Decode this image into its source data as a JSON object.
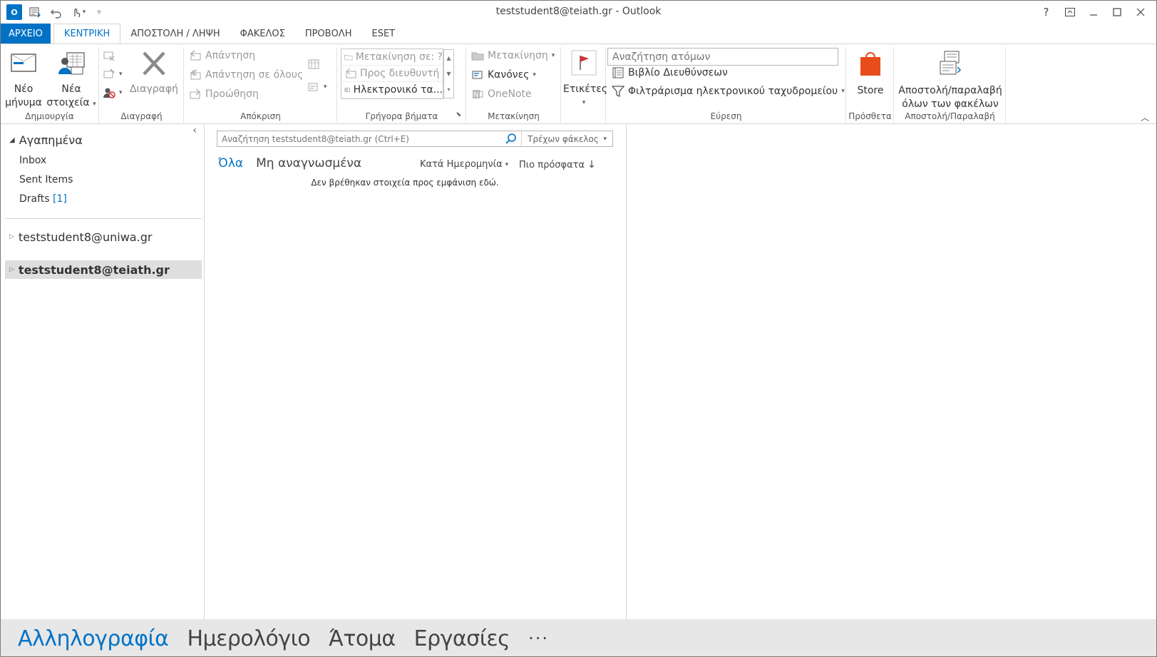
{
  "window": {
    "title": "teststudent8@teiath.gr - Outlook",
    "controls": [
      "?",
      "⧉",
      "—",
      "☐",
      "✕"
    ]
  },
  "qat": {
    "logo_text": "O"
  },
  "ribbon_tabs": [
    {
      "label": "ΑΡΧΕΙΟ"
    },
    {
      "label": "ΚΕΝΤΡΙΚΗ"
    },
    {
      "label": "ΑΠΟΣΤΟΛΗ / ΛΗΨΗ"
    },
    {
      "label": "ΦΑΚΕΛΟΣ"
    },
    {
      "label": "ΠΡΟΒΟΛΗ"
    },
    {
      "label": "ESET"
    }
  ],
  "ribbon": {
    "new_group": {
      "label": "Δημιουργία",
      "new_email": "Νέο\nμήνυμα",
      "new_items": "Νέα\nστοιχεία"
    },
    "delete_group": {
      "label": "Διαγραφή",
      "delete": "Διαγραφή"
    },
    "respond_group": {
      "label": "Απόκριση",
      "reply": "Απάντηση",
      "reply_all": "Απάντηση σε όλους",
      "forward": "Προώθηση"
    },
    "quick_steps_group": {
      "label": "Γρήγορα βήματα",
      "items": [
        "Μετακίνηση σε: ?",
        "Προς διευθυντή",
        "Ηλεκτρονικό τα..."
      ]
    },
    "move_group": {
      "label": "Μετακίνηση",
      "move": "Μετακίνηση",
      "rules": "Κανόνες",
      "onenote": "OneNote"
    },
    "tags_group": {
      "tags": "Ετικέτες"
    },
    "find_group": {
      "label": "Εύρεση",
      "search_people_placeholder": "Αναζήτηση ατόμων",
      "address_book": "Βιβλίο Διευθύνσεων",
      "filter_email": "Φιλτράρισμα ηλεκτρονικού ταχυδρομείου"
    },
    "addins_group": {
      "label": "Πρόσθετα",
      "store": "Store"
    },
    "sendreceive_group": {
      "label": "Αποστολή/Παραλαβή",
      "send_receive_all": "Αποστολή/παραλαβή\nόλων των φακέλων"
    }
  },
  "folder_pane": {
    "favorites_label": "Αγαπημένα",
    "favorites": [
      {
        "name": "Inbox",
        "count": ""
      },
      {
        "name": "Sent Items",
        "count": ""
      },
      {
        "name": "Drafts",
        "count": "[1]"
      }
    ],
    "accounts": [
      {
        "name": "teststudent8@uniwa.gr"
      },
      {
        "name": "teststudent8@teiath.gr"
      }
    ]
  },
  "message_list": {
    "search_placeholder": "Αναζήτηση teststudent8@teiath.gr (Ctrl+E)",
    "search_scope": "Τρέχων φάκελος",
    "filters": [
      "Όλα",
      "Μη αναγνωσμένα"
    ],
    "sort_by": "Κατά Ημερομηνία",
    "sort_order": "Πιο πρόσφατα",
    "empty_message": "Δεν βρέθηκαν στοιχεία προς εμφάνιση εδώ."
  },
  "navbar": {
    "items": [
      "Αλληλογραφία",
      "Ημερολόγιο",
      "Άτομα",
      "Εργασίες"
    ],
    "more": "···"
  },
  "colors": {
    "accent": "#0072c6",
    "store": "#e74c1c",
    "flag": "#d13438",
    "navbar_bg": "#e7e7e7",
    "selected_bg": "#dedede"
  }
}
